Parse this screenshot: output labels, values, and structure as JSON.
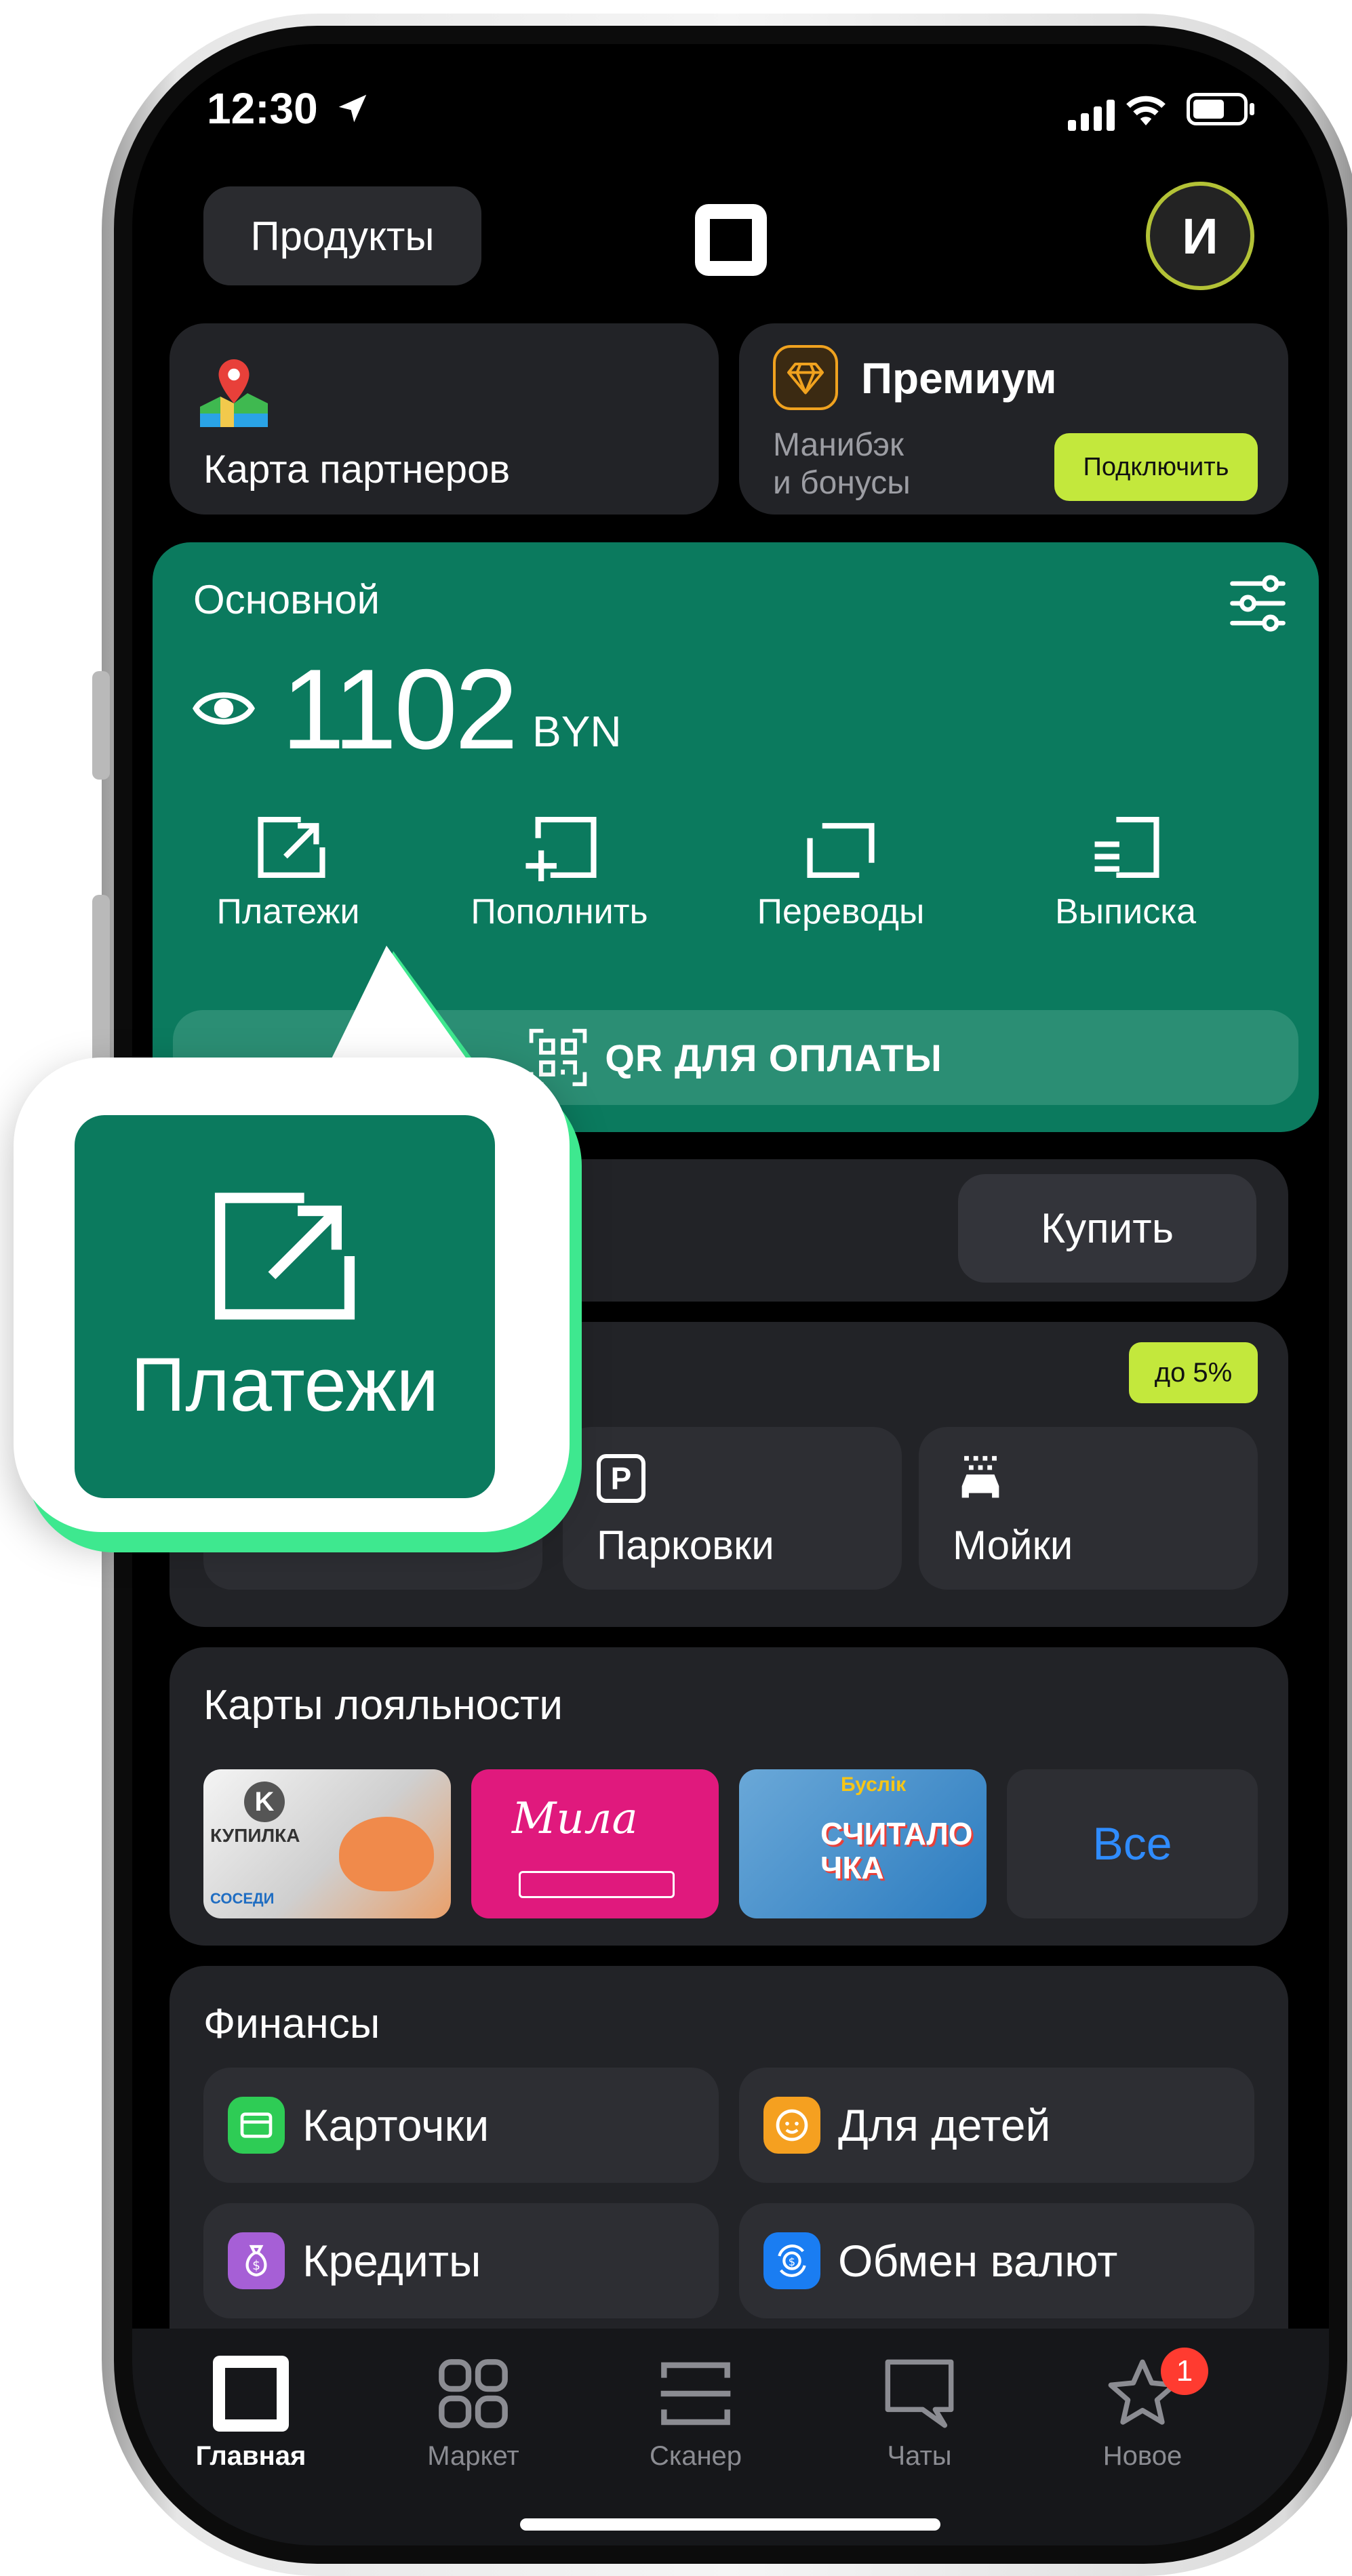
{
  "status_bar": {
    "time": "12:30"
  },
  "header": {
    "products_label": "Продукты",
    "avatar_initial": "И"
  },
  "partners": {
    "label": "Карта партнеров"
  },
  "premium": {
    "title": "Премиум",
    "subtitle_line1": "Манибэк",
    "subtitle_line2": "и бонусы",
    "connect_label": "Подключить"
  },
  "account": {
    "name": "Основной",
    "balance": "1102",
    "currency": "BYN",
    "actions": [
      {
        "label": "Платежи",
        "icon": "payment-out-icon"
      },
      {
        "label": "Пополнить",
        "icon": "top-up-icon"
      },
      {
        "label": "Переводы",
        "icon": "transfer-icon"
      },
      {
        "label": "Выписка",
        "icon": "statement-icon"
      }
    ],
    "qr_label": "QR ДЛЯ ОПЛАТЫ"
  },
  "buy": {
    "button_label": "Купить"
  },
  "auto": {
    "badge": "до 5%",
    "tiles": [
      {
        "label": "Парковки",
        "icon": "parking-icon"
      },
      {
        "label": "Мойки",
        "icon": "car-wash-icon"
      }
    ]
  },
  "loyalty": {
    "title": "Карты лояльности",
    "all_label": "Все",
    "cards": [
      {
        "brand": "КУПИЛКА",
        "sub": "СОСЕДИ",
        "color": "#8f8f8f"
      },
      {
        "brand": "Мила",
        "color": "#e0197d"
      },
      {
        "brand": "СЧИТАЛОЧКА",
        "top": "Буслік",
        "color": "#2b7bbf"
      }
    ]
  },
  "finance": {
    "title": "Финансы",
    "items": [
      {
        "label": "Карточки",
        "icon": "card-icon",
        "color": "#2ecc55"
      },
      {
        "label": "Для детей",
        "icon": "kid-face-icon",
        "color": "#f5a020"
      },
      {
        "label": "Кредиты",
        "icon": "money-bag-icon",
        "color": "#a65fd6"
      },
      {
        "label": "Обмен валют",
        "icon": "currency-exchange-icon",
        "color": "#1a7df2"
      }
    ]
  },
  "bottom_nav": [
    {
      "label": "Главная",
      "icon": "home-square-icon",
      "active": true
    },
    {
      "label": "Маркет",
      "icon": "grid-icon",
      "active": false
    },
    {
      "label": "Сканер",
      "icon": "scanner-icon",
      "active": false
    },
    {
      "label": "Чаты",
      "icon": "chat-icon",
      "active": false
    },
    {
      "label": "Новое",
      "icon": "star-icon",
      "active": false,
      "badge": "1"
    }
  ],
  "callout": {
    "label": "Платежи"
  },
  "colors": {
    "accent_green": "#0b7a5e",
    "lime": "#c3e83c",
    "callout_shadow": "#3ee88f",
    "link_blue": "#2f8cff"
  }
}
